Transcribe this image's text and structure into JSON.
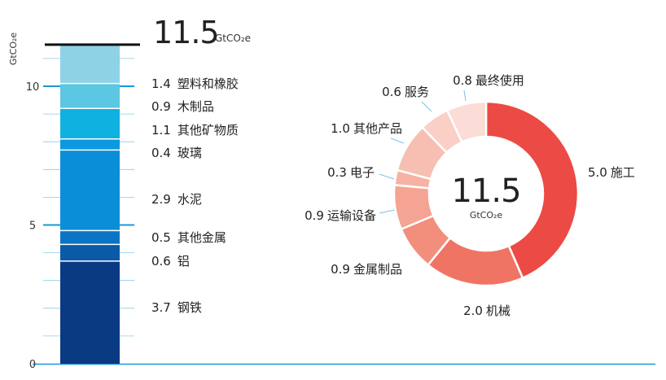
{
  "unit_text": "GtCO₂e",
  "total_label": "11.5",
  "chart_data": [
    {
      "type": "bar",
      "stacked": true,
      "ylabel": "GtCO₂e",
      "ylim": [
        0,
        12
      ],
      "yticks": [
        0,
        5,
        10
      ],
      "ytick_labels": [
        "0",
        "5",
        "10"
      ],
      "total": 11.5,
      "total_label": "11.5",
      "categories": [
        "钢铁",
        "铝",
        "其他金属",
        "水泥",
        "玻璃",
        "其他矿物质",
        "木制品",
        "塑料和橡胶"
      ],
      "values": [
        3.7,
        0.6,
        0.5,
        2.9,
        0.4,
        1.1,
        0.9,
        1.4
      ],
      "value_labels": [
        "3.7",
        "0.6",
        "0.5",
        "2.9",
        "0.4",
        "1.1",
        "0.9",
        "1.4"
      ],
      "colors": [
        "#0a3a82",
        "#0a5aa8",
        "#0b74c5",
        "#0b8ed8",
        "#0b9adf",
        "#0fb1e0",
        "#5cc7e2",
        "#8ed2e6"
      ]
    },
    {
      "type": "pie",
      "donut": true,
      "center_value": "11.5",
      "center_unit": "GtCO₂e",
      "categories": [
        "施工",
        "机械",
        "金属制品",
        "运输设备",
        "电子",
        "其他产品",
        "服务",
        "最终使用"
      ],
      "values": [
        5.0,
        2.0,
        0.9,
        0.9,
        0.3,
        1.0,
        0.6,
        0.8
      ],
      "value_labels": [
        "5.0",
        "2.0",
        "0.9",
        "0.9",
        "0.3",
        "1.0",
        "0.6",
        "0.8"
      ],
      "colors": [
        "#ec4a44",
        "#f07464",
        "#f28e7c",
        "#f5a392",
        "#f6b3a5",
        "#f7bfb2",
        "#f9cfc6",
        "#fbdcd6"
      ]
    }
  ]
}
